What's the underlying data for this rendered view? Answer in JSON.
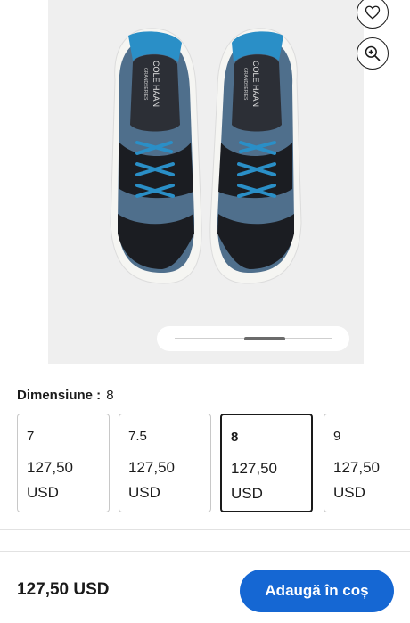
{
  "product": {
    "brand_text": "COLE HAAN",
    "sub_brand_text": "GRANDSERIES"
  },
  "actions": {
    "favorite_icon": "heart-icon",
    "zoom_icon": "zoom-in-icon"
  },
  "size_selector": {
    "label": "Dimensiune :",
    "selected_value": "8",
    "options": [
      {
        "size": "7",
        "price": "127,50",
        "currency": "USD",
        "selected": false
      },
      {
        "size": "7.5",
        "price": "127,50",
        "currency": "USD",
        "selected": false
      },
      {
        "size": "8",
        "price": "127,50",
        "currency": "USD",
        "selected": true
      },
      {
        "size": "9",
        "price": "127,50",
        "currency": "USD",
        "selected": false
      }
    ]
  },
  "footer": {
    "total_price": "127,50 USD",
    "add_to_cart_label": "Adaugă în coș"
  },
  "colors": {
    "accent": "#1567d3",
    "shoe_suede": "#4f6f8c",
    "shoe_black": "#1b1d22",
    "laces": "#2a8fc7"
  }
}
